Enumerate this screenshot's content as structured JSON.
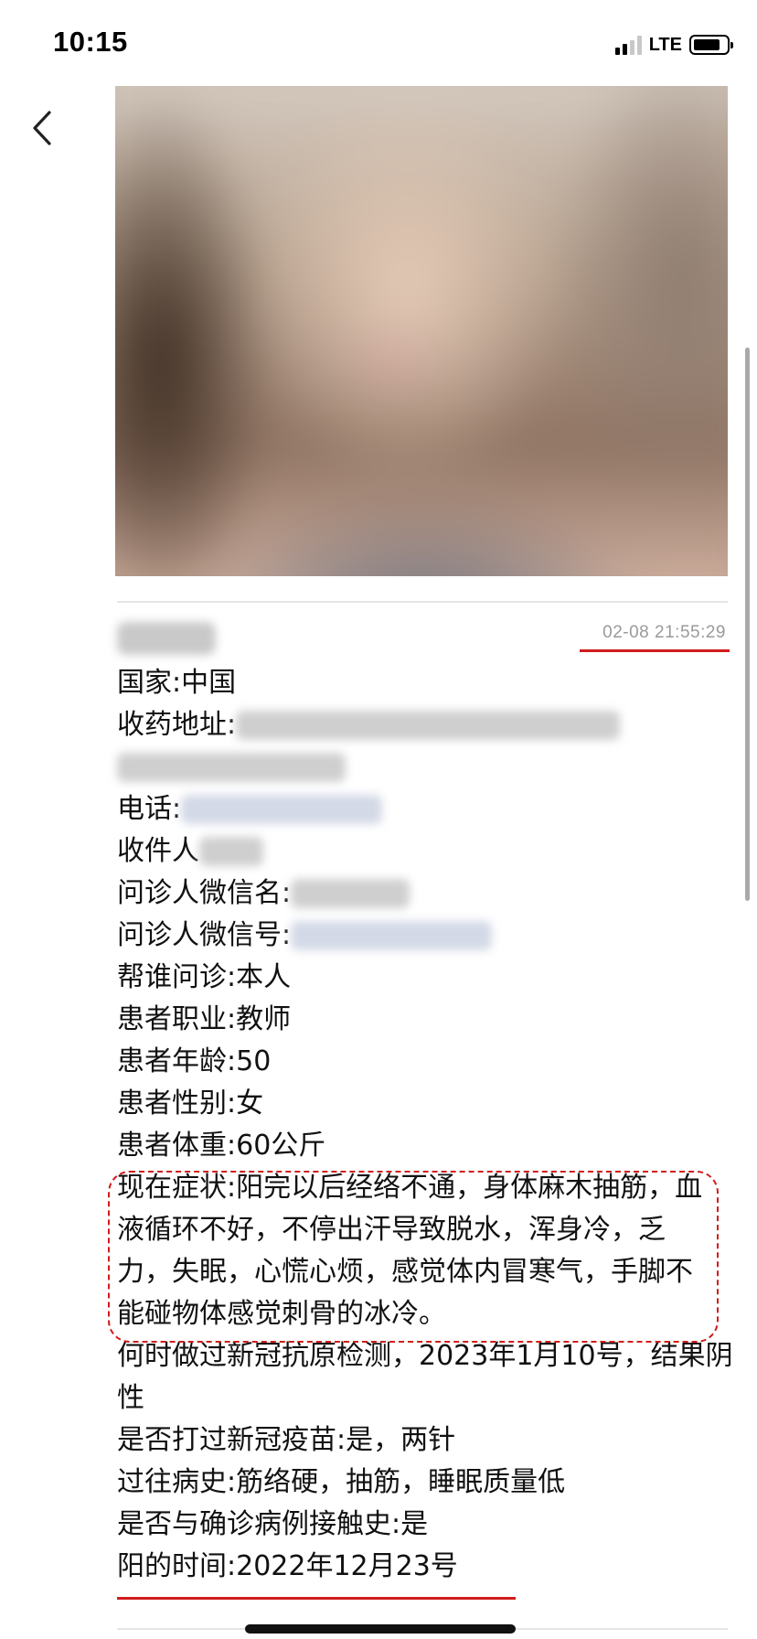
{
  "status_bar": {
    "time": "10:15",
    "network": "LTE",
    "signal_bars_filled": 2,
    "signal_bars_total": 4
  },
  "message": {
    "timestamp": "02-08 21:55:29",
    "fields": {
      "country": "国家:中国",
      "address_label": "收药地址:",
      "phone_label": "电话:",
      "recipient_label": "收件人",
      "wechat_name_label": "问诊人微信名:",
      "wechat_id_label": "问诊人微信号:",
      "consult_for": "帮谁问诊:本人",
      "occupation": "患者职业:教师",
      "age": "患者年龄:50",
      "gender": "患者性别:女",
      "weight": "患者体重:60公斤",
      "symptoms": "现在症状:阳完以后经络不通，身体麻木抽筋，血液循环不好，不停出汗导致脱水，浑身冷，乏力，失眠，心慌心烦，感觉体内冒寒气，手脚不能碰物体感觉刺骨的冰冷。",
      "antigen_test": "何时做过新冠抗原检测，2023年1月10号，结果阴性",
      "vaccinated": "是否打过新冠疫苗:是，两针",
      "history": "过往病史:筋络硬，抽筋，睡眠质量低",
      "contact": "是否与确诊病例接触史:是",
      "positive_date": "阳的时间:2022年12月23号"
    }
  },
  "colors": {
    "annotation_red": "#d11c1c",
    "timestamp_gray": "#9a9a9a"
  }
}
